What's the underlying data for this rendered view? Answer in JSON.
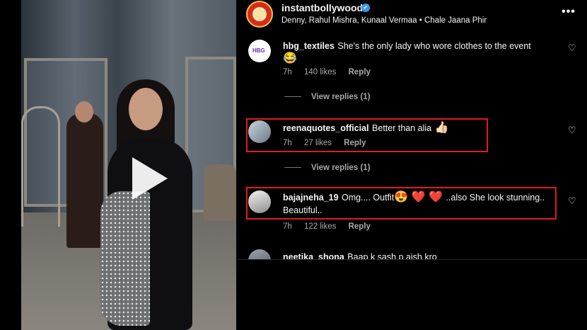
{
  "post": {
    "username": "instantbollywood",
    "audio": "Denny, Rahul Mishra, Kunaal Vermaa • Chale Jaana Phir",
    "more_label": "•••",
    "verified_mark": "✔"
  },
  "comments": [
    {
      "username": "hbg_textiles",
      "text": "She's the only lady who wore clothes to the event",
      "emoji": "😂",
      "time": "7h",
      "likes": "140 likes",
      "reply": "Reply",
      "view_replies": "View replies (1)",
      "avatar_text": "HBG"
    },
    {
      "username": "reenaquotes_official",
      "text": "Better than alia",
      "emoji": "👍🏻",
      "time": "7h",
      "likes": "27 likes",
      "reply": "Reply",
      "view_replies": "View replies (1)"
    },
    {
      "username": "bajajneha_19",
      "text_line1": "Omg.... Outfit",
      "emoji_a": "😍",
      "emoji_b": "❤️",
      "emoji_c": "❤️",
      "text_tail": "..also She look stunning..",
      "text_line2": "Beautiful..",
      "time": "7h",
      "likes": "122 likes",
      "reply": "Reply"
    },
    {
      "username": "neetika_shona",
      "text": "Baap k sash p aish kro"
    }
  ],
  "icons": {
    "heart": "♡",
    "play": "play-icon"
  },
  "colors": {
    "highlight": "#e21a1a",
    "verified": "#3897f0",
    "meta": "#a8a8a8"
  }
}
